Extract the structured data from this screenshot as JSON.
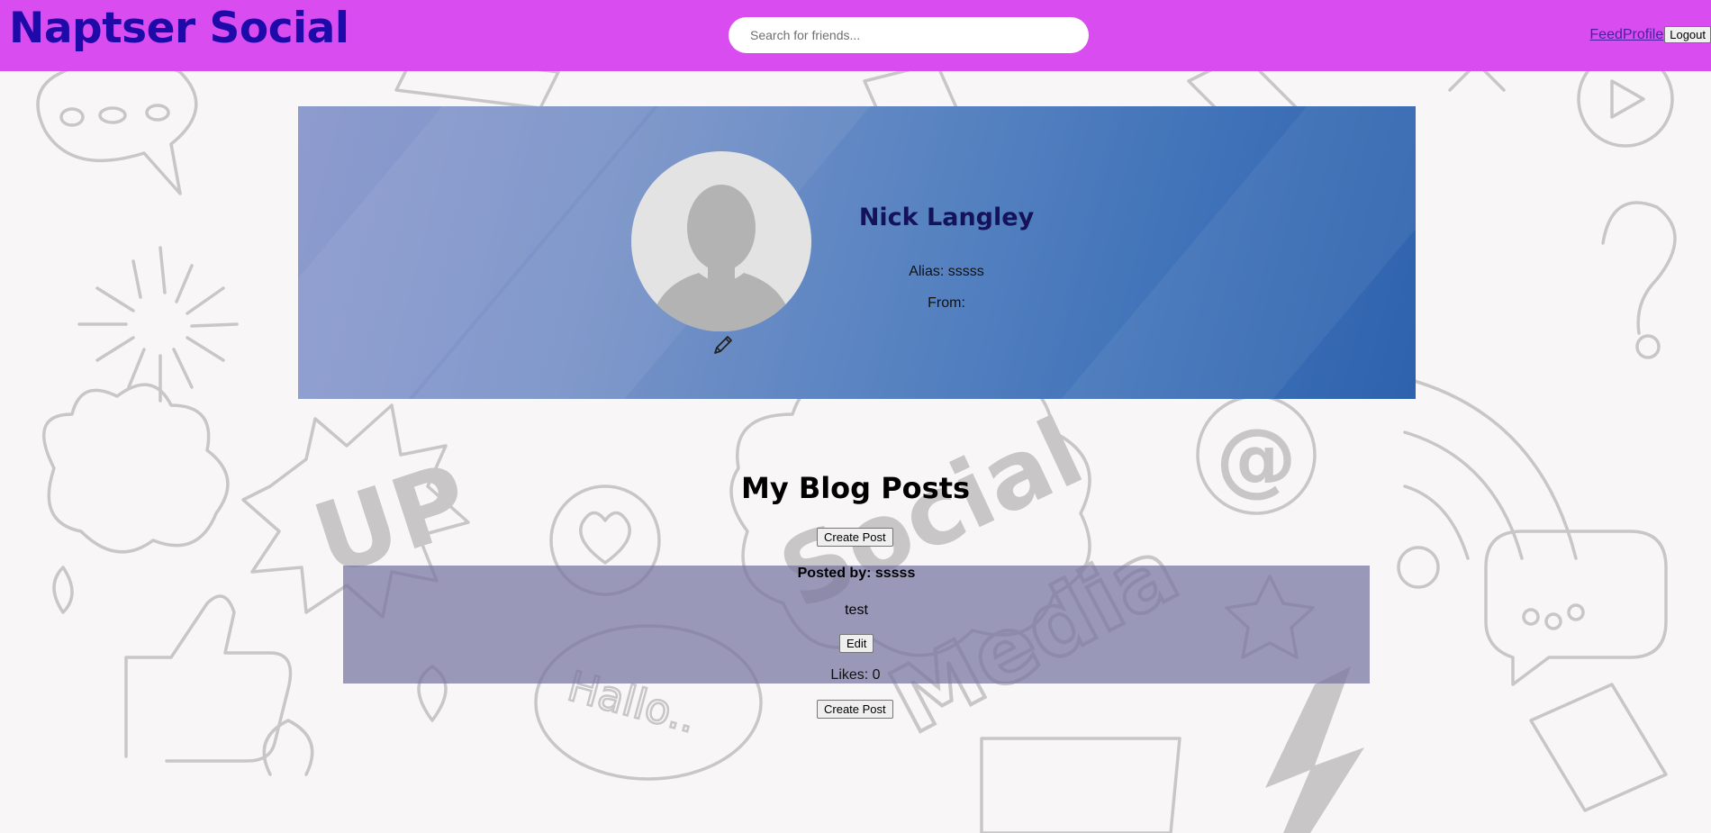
{
  "header": {
    "brand": "Naptser Social",
    "search_placeholder": "Search for friends...",
    "nav": {
      "feed": "Feed",
      "profile": "Profile",
      "logout": "Logout"
    }
  },
  "profile": {
    "name": "Nick Langley",
    "alias_label": "Alias: sssss",
    "from_label": "From:"
  },
  "posts": {
    "heading": "My Blog Posts",
    "create_label": "Create Post",
    "items": [
      {
        "author_label": "Posted by: sssss",
        "content": "test",
        "edit_label": "Edit",
        "likes_label": "Likes: 0"
      }
    ]
  },
  "background": {
    "words": {
      "social": "Social",
      "media": "Media",
      "up": "UP",
      "hallo": "Hallo..",
      "at": "@"
    }
  },
  "colors": {
    "header": "#d94cf0",
    "brand": "#1d0aa8",
    "post_card": "#7673a0"
  }
}
